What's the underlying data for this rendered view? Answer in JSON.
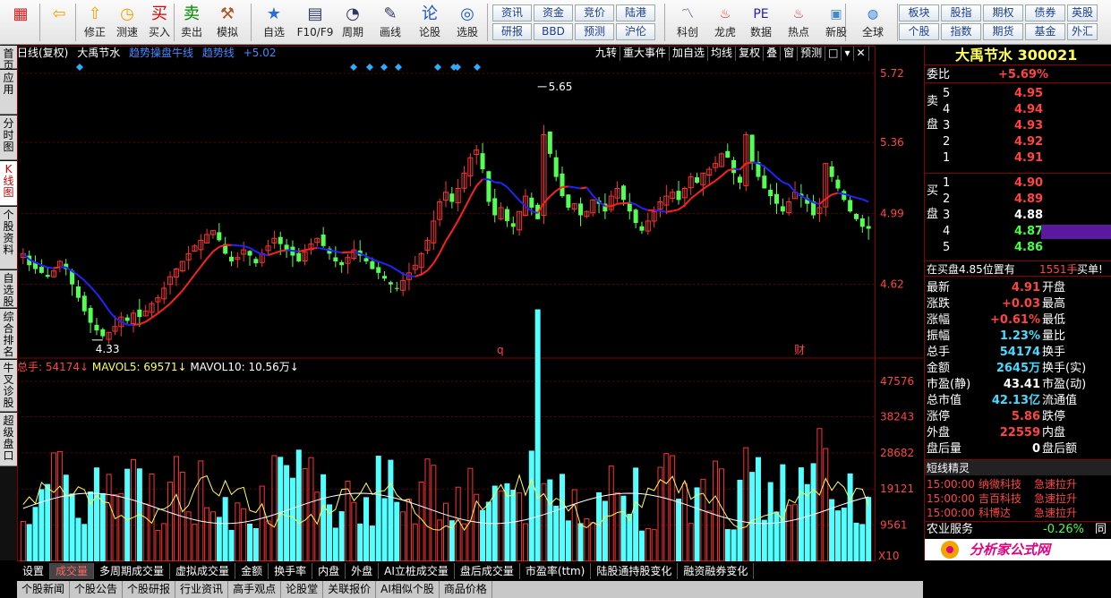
{
  "toolbar": {
    "buttons": [
      {
        "label": "",
        "icon": "window-grid-icon",
        "name": "grid-button"
      },
      {
        "label": "",
        "icon": "back-arrow-icon",
        "name": "back-button"
      },
      {
        "label": "修正",
        "icon": "up-arrow-icon",
        "name": "fix-button"
      },
      {
        "label": "测速",
        "icon": "clock-icon",
        "name": "speedtest-button"
      },
      {
        "label": "买入",
        "icon": "buy-icon",
        "name": "buy-button"
      },
      {
        "label": "卖出",
        "icon": "sell-icon",
        "name": "sell-button"
      },
      {
        "label": "模拟",
        "icon": "hammer-icon",
        "name": "simulate-button"
      },
      {
        "label": "自选",
        "icon": "star-icon",
        "name": "watchlist-button"
      },
      {
        "label": "F10/F9",
        "icon": "document-icon",
        "name": "f10-button"
      },
      {
        "label": "周期",
        "icon": "cycle-icon",
        "name": "period-button"
      },
      {
        "label": "画线",
        "icon": "pencil-icon",
        "name": "drawline-button"
      },
      {
        "label": "论股",
        "icon": "discuss-icon",
        "name": "discuss-button"
      },
      {
        "label": "选股",
        "icon": "screener-icon",
        "name": "stockpick-button"
      }
    ],
    "small_buttons": [
      [
        "资讯",
        "资金",
        "竞价",
        "陆港"
      ],
      [
        "研报",
        "BBD",
        "预测",
        "沪伦"
      ]
    ],
    "buttons2": [
      {
        "label": "科创",
        "icon": "chart-icon",
        "name": "star-market-button"
      },
      {
        "label": "龙虎",
        "icon": "dragon-icon",
        "name": "dragon-tiger-button"
      },
      {
        "label": "数据",
        "icon": "pe-icon",
        "name": "data-button"
      },
      {
        "label": "热点",
        "icon": "hot-icon",
        "name": "hot-button"
      },
      {
        "label": "新股",
        "icon": "ipo-icon",
        "name": "ipo-button"
      },
      {
        "label": "全球",
        "icon": "globe-icon",
        "name": "global-button"
      }
    ],
    "market_buttons": [
      [
        "板块",
        "股指",
        "期权",
        "债券",
        "英股"
      ],
      [
        "个股",
        "指数",
        "期货",
        "基金",
        "外汇"
      ]
    ]
  },
  "sidebar": [
    "首页",
    "应用",
    "分时图",
    "K线图",
    "个股资料",
    "自选股",
    "综合排名",
    "牛叉诊股",
    "超级盘口"
  ],
  "info": {
    "title": "日线(复权)",
    "stock": "大禹节水",
    "ind1": "趋势操盘牛线",
    "ind2": "趋势线",
    "val": "+5.02"
  },
  "chart_toolbar": [
    "九转",
    "重大事件",
    "加自选",
    "均线",
    "复权",
    "叠",
    "窗",
    "预测"
  ],
  "price_axis": [
    "5.72",
    "5.36",
    "4.99",
    "4.62"
  ],
  "vol_axis": [
    "47576",
    "38243",
    "28682",
    "19121",
    "9561",
    "X10"
  ],
  "annotations": {
    "high": "5.65",
    "low": "4.33",
    "marker_q": "q",
    "marker_cai": "财"
  },
  "volinfo": {
    "total": "总手: 54174↓",
    "ma5": "MAVOL5: 69571↓",
    "ma10": "MAVOL10: 10.56万↓"
  },
  "bottom_tabs": [
    "设置",
    "成交量",
    "多周期成交量",
    "虚拟成交量",
    "金额",
    "换手率",
    "内盘",
    "外盘",
    "AI立桩成交量",
    "盘后成交量",
    "市盈率(ttm)",
    "陆股通持股变化",
    "融资融券变化"
  ],
  "stock_tabs": [
    "个股新闻",
    "个股公告",
    "个股研报",
    "行业资讯",
    "高手观点",
    "论股堂",
    "关联报价",
    "AI相似个股",
    "商品价格"
  ],
  "right": {
    "name": "大禹节水",
    "code": "300021",
    "wb_label": "委比",
    "wb": "+5.69%",
    "sell_label": "卖盘",
    "buy_label": "买盘",
    "sells": [
      [
        "5",
        "4.95"
      ],
      [
        "4",
        "4.94"
      ],
      [
        "3",
        "4.93"
      ],
      [
        "2",
        "4.92"
      ],
      [
        "1",
        "4.91"
      ]
    ],
    "buys": [
      [
        "1",
        "4.90"
      ],
      [
        "2",
        "4.89"
      ],
      [
        "3",
        "4.88"
      ],
      [
        "4",
        "4.87"
      ],
      [
        "5",
        "4.86"
      ]
    ],
    "note": "在买盘4.85位置有",
    "note_vol": "1551手",
    "note_act": "买单!",
    "quotes": [
      [
        "最新",
        "4.91",
        "开盘"
      ],
      [
        "涨跌",
        "+0.03",
        "最高"
      ],
      [
        "涨幅",
        "+0.61%",
        "最低"
      ],
      [
        "振幅",
        "1.23%",
        "量比"
      ],
      [
        "总手",
        "54174",
        "换手"
      ],
      [
        "金额",
        "2645万",
        "换手(实)"
      ],
      [
        "市盈(静)",
        "43.41",
        "市盈(动)"
      ],
      [
        "总市值",
        "42.13亿",
        "流通值"
      ],
      [
        "涨停",
        "5.86",
        "跌停"
      ],
      [
        "外盘",
        "22559",
        "内盘"
      ],
      [
        "盘后量",
        "0",
        "盘后额"
      ]
    ],
    "elf_title": "短线精灵",
    "elf": [
      [
        "15:00:00",
        "纳微科技",
        "急速拉升"
      ],
      [
        "15:00:00",
        "吉百科技",
        "急速拉升"
      ],
      [
        "15:00:00",
        "科博达",
        "急速拉升"
      ]
    ],
    "industry": "农业服务",
    "industry_chg": "-0.26%",
    "industry_extra": "同"
  },
  "chart_data": {
    "type": "candlestick",
    "price_range": [
      4.25,
      5.78
    ],
    "high": 5.65,
    "low": 4.33,
    "volume_max": 47576,
    "seed": "price path approximated from screenshot",
    "closes": [
      4.78,
      4.72,
      4.7,
      4.68,
      4.66,
      4.69,
      4.74,
      4.7,
      4.62,
      4.55,
      4.48,
      4.42,
      4.38,
      4.35,
      4.37,
      4.4,
      4.45,
      4.43,
      4.47,
      4.45,
      4.48,
      4.52,
      4.55,
      4.6,
      4.66,
      4.7,
      4.74,
      4.78,
      4.82,
      4.85,
      4.88,
      4.9,
      4.85,
      4.78,
      4.74,
      4.76,
      4.8,
      4.77,
      4.73,
      4.78,
      4.82,
      4.86,
      4.83,
      4.8,
      4.77,
      4.74,
      4.79,
      4.83,
      4.86,
      4.82,
      4.78,
      4.74,
      4.72,
      4.76,
      4.8,
      4.77,
      4.74,
      4.7,
      4.68,
      4.65,
      4.62,
      4.6,
      4.64,
      4.68,
      4.72,
      4.78,
      4.85,
      4.95,
      5.05,
      5.1,
      5.05,
      5.12,
      5.2,
      5.28,
      5.32,
      5.22,
      5.05,
      4.98,
      5.02,
      4.95,
      4.92,
      5.0,
      5.08,
      5.02,
      4.96,
      5.4,
      5.3,
      5.18,
      5.08,
      5.02,
      5.04,
      4.98,
      5.0,
      5.06,
      5.04,
      5.0,
      5.08,
      5.12,
      5.06,
      5.0,
      4.94,
      4.9,
      4.95,
      5.0,
      5.05,
      5.08,
      5.1,
      5.06,
      5.12,
      5.18,
      5.15,
      5.2,
      5.22,
      5.25,
      5.3,
      5.28,
      5.2,
      5.15,
      5.4,
      5.25,
      5.18,
      5.12,
      5.08,
      5.04,
      5.0,
      5.05,
      5.1,
      5.08,
      5.04,
      4.98,
      5.02,
      5.25,
      5.18,
      5.12,
      5.06,
      5.0,
      4.96,
      4.92,
      4.91
    ]
  }
}
